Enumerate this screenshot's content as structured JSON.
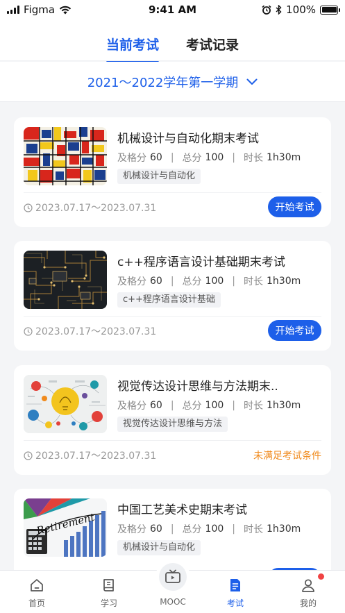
{
  "status_bar": {
    "carrier": "Figma",
    "time": "9:41 AM",
    "battery": "100%"
  },
  "tabs": [
    {
      "label": "当前考试",
      "active": true
    },
    {
      "label": "考试记录",
      "active": false
    }
  ],
  "semester": {
    "label": "2021～2022学年第一学期",
    "icon": "chevron-down-icon"
  },
  "labels": {
    "pass_score": "及格分",
    "total_score": "总分",
    "duration": "时长"
  },
  "exams": [
    {
      "title": "机械设计与自动化期末考试",
      "pass_score": "60",
      "total_score": "100",
      "duration": "1h30m",
      "course_tag": "机械设计与自动化",
      "date_range": "2023.07.17～2023.07.31",
      "action": "开始考试",
      "image": "mondrian-grid"
    },
    {
      "title": "c++程序语言设计基础期末考试",
      "pass_score": "60",
      "total_score": "100",
      "duration": "1h30m",
      "course_tag": "c++程序语言设计基础",
      "date_range": "2023.07.17～2023.07.31",
      "action": "开始考试",
      "image": "circuit-board"
    },
    {
      "title": "视觉传达设计思维与方法期末..",
      "pass_score": "60",
      "total_score": "100",
      "duration": "1h30m",
      "course_tag": "视觉传达设计思维与方法",
      "date_range": "2023.07.17～2023.07.31",
      "status_text": "未满足考试条件",
      "image": "lightbulb-infographic"
    },
    {
      "title": "中国工艺美术史期末考试",
      "pass_score": "60",
      "total_score": "100",
      "duration": "1h30m",
      "course_tag": "机械设计与自动化",
      "image": "retirement-chart"
    }
  ],
  "tabbar": [
    {
      "label": "首页",
      "icon": "home-icon"
    },
    {
      "label": "学习",
      "icon": "book-icon"
    },
    {
      "label": "MOOC",
      "icon": "tv-icon"
    },
    {
      "label": "考试",
      "icon": "exam-doc-icon",
      "active": true
    },
    {
      "label": "我的",
      "icon": "user-icon",
      "badge": true
    }
  ],
  "colors": {
    "primary": "#1d5fe9",
    "warning": "#f08a1c",
    "badge": "#f04343"
  }
}
